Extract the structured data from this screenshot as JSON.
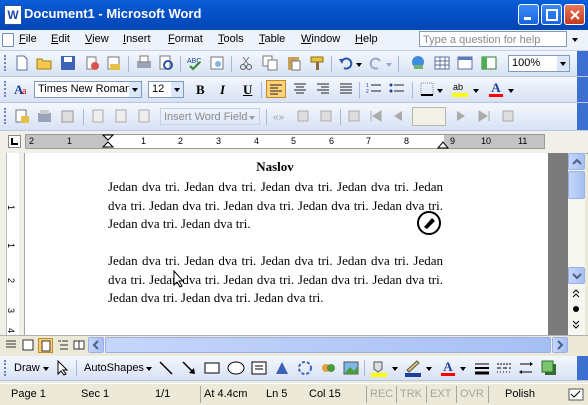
{
  "window": {
    "title": "Document1 - Microsoft Word",
    "app_icon": "W"
  },
  "menubar": {
    "items": [
      "File",
      "Edit",
      "View",
      "Insert",
      "Format",
      "Tools",
      "Table",
      "Window",
      "Help"
    ],
    "help_placeholder": "Type a question for help"
  },
  "standard_toolbar": {
    "zoom": "100%"
  },
  "formatting_toolbar": {
    "font": "Times New Roman",
    "size": "12",
    "bold": "B",
    "italic": "I",
    "underline": "U",
    "font_color_label": "A"
  },
  "mail_merge_toolbar": {
    "insert_word_field": "Insert Word Field"
  },
  "ruler": {
    "numbers_left": [
      "2",
      "1"
    ],
    "numbers_right": [
      "1",
      "2",
      "3",
      "4",
      "5",
      "6",
      "7",
      "8",
      "9",
      "10",
      "11"
    ]
  },
  "vruler": {
    "numbers": [
      "1",
      "1",
      "2",
      "3",
      "4"
    ]
  },
  "document": {
    "heading": "Naslov",
    "paragraphs": [
      "Jedan dva tri. Jedan dva tri. Jedan dva tri. Jedan dva tri. Jedan dva tri. Jedan dva tri. Jedan dva tri. Jedan dva tri. Jedan dva tri. Jedan dva tri. Jedan dva tri.",
      "Jedan dva tri. Jedan dva tri. Jedan dva tri. Jedan dva tri. Jedan dva tri. Jedan dva tri. Jedan dva tri. Jedan dva tri. Jedan dva tri. Jedan dva tri. Jedan dva tri. Jedan dva tri."
    ]
  },
  "drawing_toolbar": {
    "draw": "Draw",
    "autoshapes": "AutoShapes"
  },
  "statusbar": {
    "page": "Page 1",
    "sec": "Sec 1",
    "pages": "1/1",
    "at": "At 4.4cm",
    "ln": "Ln 5",
    "col": "Col 15",
    "rec": "REC",
    "trk": "TRK",
    "ext": "EXT",
    "ovr": "OVR",
    "language": "Polish"
  },
  "colors": {
    "title_bar": "#0a5fd8",
    "highlight": "#ffff00",
    "font_color": "#ff0000"
  }
}
